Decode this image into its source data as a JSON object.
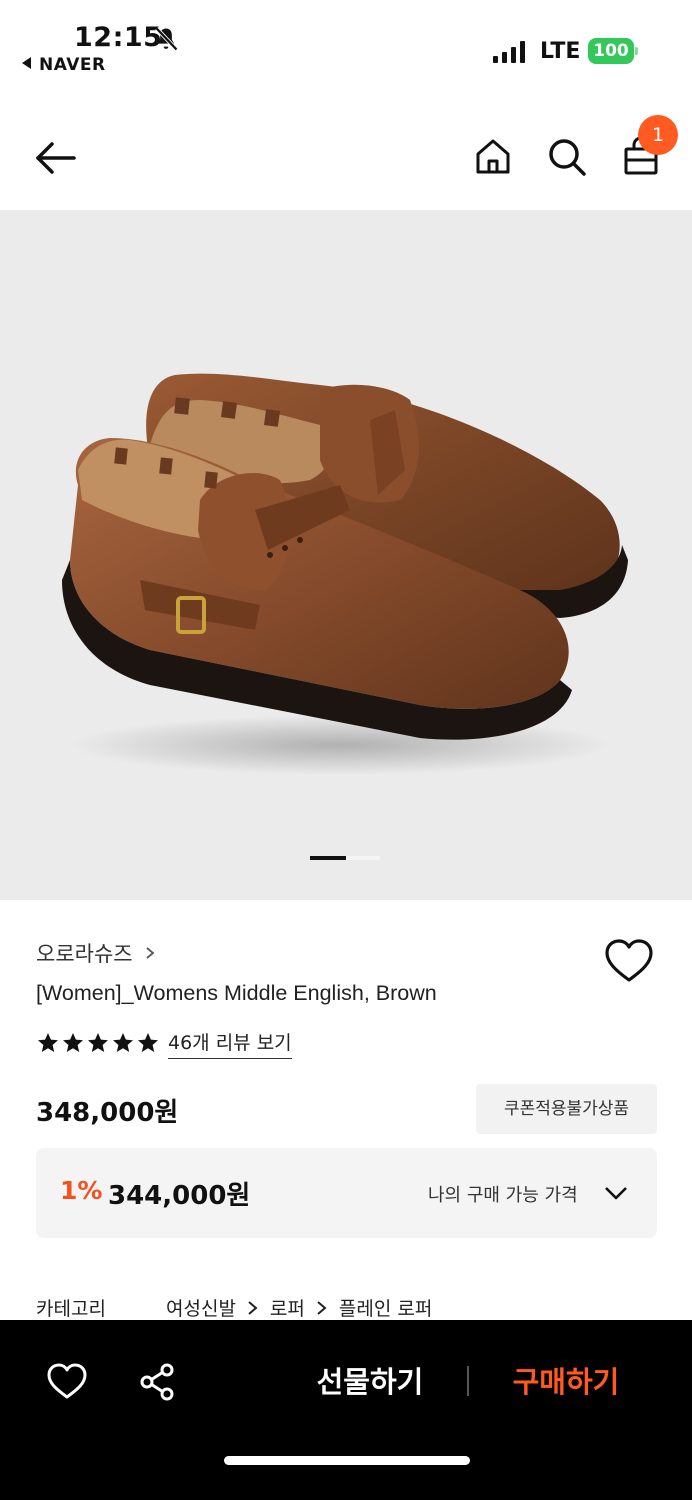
{
  "status_bar": {
    "time": "12:15",
    "back_app": "NAVER",
    "network": "LTE",
    "battery": "100"
  },
  "header": {
    "cart_count": "1",
    "icons": [
      "back-arrow-icon",
      "home-icon",
      "search-icon",
      "shopping-bag-icon"
    ]
  },
  "product": {
    "brand": "오로라슈즈",
    "title": "[Women]_Womens Middle English, Brown",
    "rating_stars": 5,
    "review_link": "46개 리뷰 보기",
    "price": "348,000원",
    "coupon_tag": "쿠폰적용불가상품",
    "my_price": {
      "discount": "1%",
      "amount": "344,000원",
      "label": "나의 구매 가능 가격"
    },
    "category": {
      "label": "카테고리",
      "path": [
        "여성신발",
        "로퍼",
        "플레인 로퍼"
      ]
    }
  },
  "gallery": {
    "current_page": 1,
    "image_subject": "brown leather shoes"
  },
  "bottom_bar": {
    "gift_label": "선물하기",
    "buy_label": "구매하기"
  },
  "colors": {
    "accent": "#ff5a1f",
    "badge": "#ff5a1f",
    "discount": "#f4511e",
    "battery": "#34c759",
    "bottom_bar_bg": "#000000"
  }
}
